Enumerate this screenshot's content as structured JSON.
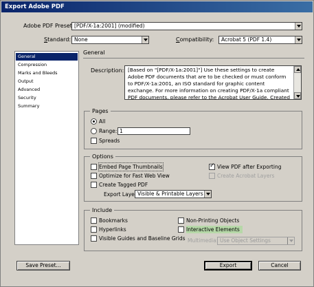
{
  "window": {
    "title": "Export Adobe PDF"
  },
  "preset": {
    "label": "Adobe PDF Preset:",
    "value": "[PDF/X-1a:2001] (modified)"
  },
  "standard": {
    "label": "Standard:",
    "value": "None"
  },
  "compatibility": {
    "label": "Compatibility:",
    "value": "Acrobat 5 (PDF 1.4)"
  },
  "sidebar": {
    "items": [
      {
        "label": "General",
        "selected": true
      },
      {
        "label": "Compression"
      },
      {
        "label": "Marks and Bleeds"
      },
      {
        "label": "Output"
      },
      {
        "label": "Advanced"
      },
      {
        "label": "Security"
      },
      {
        "label": "Summary"
      }
    ]
  },
  "panel": {
    "title": "General"
  },
  "description": {
    "label": "Description:",
    "text": "[Based on \"[PDF/X-1a:2001]\"] Use these settings to create Adobe PDF documents that are to be checked or must conform to PDF/X-1a:2001, an ISO standard for graphic content exchange. For more information on creating PDF/X-1a compliant PDF documents, please refer to the Acrobat User Guide. Created PDF documents"
  },
  "pages": {
    "title": "Pages",
    "all_label": "All",
    "range_label": "Range:",
    "range_value": "1",
    "spreads_label": "Spreads"
  },
  "options": {
    "title": "Options",
    "embed_thumbs": "Embed Page Thumbnails",
    "optimize_web": "Optimize for Fast Web View",
    "create_tagged": "Create Tagged PDF",
    "view_after": "View PDF after Exporting",
    "create_layers": "Create Acrobat Layers",
    "export_layers_label": "Export Layers:",
    "export_layers_value": "Visible & Printable Layers"
  },
  "include": {
    "title": "Include",
    "bookmarks": "Bookmarks",
    "hyperlinks": "Hyperlinks",
    "visible_guides": "Visible Guides and Baseline Grids",
    "non_printing": "Non-Printing Objects",
    "interactive": "Interactive Elements",
    "multimedia_label": "Multimedia:",
    "multimedia_value": "Use Object Settings"
  },
  "buttons": {
    "save_preset": "Save Preset...",
    "export": "Export",
    "cancel": "Cancel"
  }
}
